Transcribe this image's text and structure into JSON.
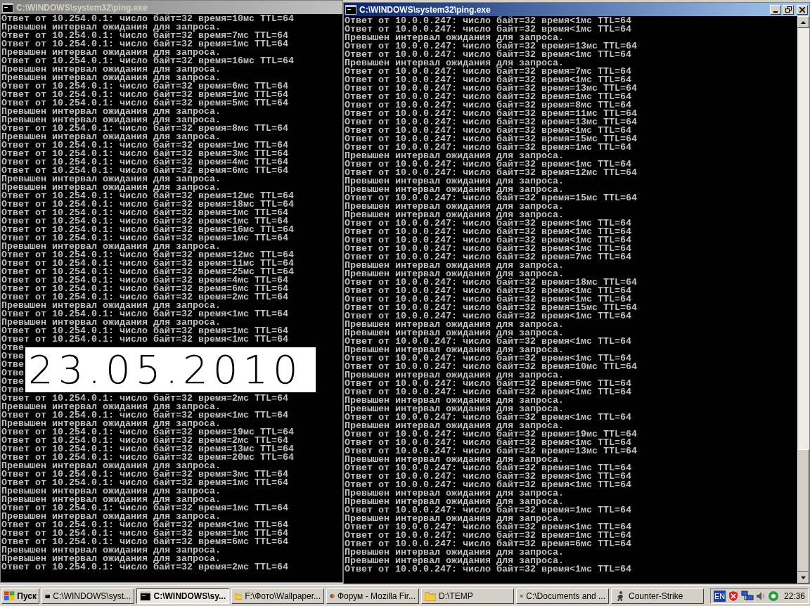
{
  "windows": [
    {
      "title": "C:\\WINDOWS\\system32\\ping.exe",
      "active": false,
      "lines": [
        "Ответ от 10.254.0.1: число байт=32 время=10мс TTL=64",
        "Превышен интервал ожидания для запроса.",
        "Ответ от 10.254.0.1: число байт=32 время=7мс TTL=64",
        "Ответ от 10.254.0.1: число байт=32 время=1мс TTL=64",
        "Превышен интервал ожидания для запроса.",
        "Ответ от 10.254.0.1: число байт=32 время=16мс TTL=64",
        "Превышен интервал ожидания для запроса.",
        "Превышен интервал ожидания для запроса.",
        "Ответ от 10.254.0.1: число байт=32 время=6мс TTL=64",
        "Ответ от 10.254.0.1: число байт=32 время=1мс TTL=64",
        "Ответ от 10.254.0.1: число байт=32 время=5мс TTL=64",
        "Превышен интервал ожидания для запроса.",
        "Превышен интервал ожидания для запроса.",
        "Ответ от 10.254.0.1: число байт=32 время=8мс TTL=64",
        "Превышен интервал ожидания для запроса.",
        "Ответ от 10.254.0.1: число байт=32 время=1мс TTL=64",
        "Ответ от 10.254.0.1: число байт=32 время=3мс TTL=64",
        "Ответ от 10.254.0.1: число байт=32 время=4мс TTL=64",
        "Ответ от 10.254.0.1: число байт=32 время=6мс TTL=64",
        "Превышен интервал ожидания для запроса.",
        "Превышен интервал ожидания для запроса.",
        "Ответ от 10.254.0.1: число байт=32 время=12мс TTL=64",
        "Ответ от 10.254.0.1: число байт=32 время=18мс TTL=64",
        "Ответ от 10.254.0.1: число байт=32 время=1мс TTL=64",
        "Ответ от 10.254.0.1: число байт=32 время<1мс TTL=64",
        "Ответ от 10.254.0.1: число байт=32 время=16мс TTL=64",
        "Ответ от 10.254.0.1: число байт=32 время=1мс TTL=64",
        "Превышен интервал ожидания для запроса.",
        "Ответ от 10.254.0.1: число байт=32 время=12мс TTL=64",
        "Ответ от 10.254.0.1: число байт=32 время=11мс TTL=64",
        "Ответ от 10.254.0.1: число байт=32 время=25мс TTL=64",
        "Ответ от 10.254.0.1: число байт=32 время=4мс TTL=64",
        "Ответ от 10.254.0.1: число байт=32 время=6мс TTL=64",
        "Ответ от 10.254.0.1: число байт=32 время=2мс TTL=64",
        "Превышен интервал ожидания для запроса.",
        "Ответ от 10.254.0.1: число байт=32 время<1мс TTL=64",
        "Превышен интервал ожидания для запроса.",
        "Ответ от 10.254.0.1: число байт=32 время=1мс TTL=64",
        "Ответ от 10.254.0.1: число байт=32 время<1мс TTL=64",
        "Отве",
        "Отве",
        "Отве",
        "Отве",
        "Отве",
        "Отве",
        "Ответ от 10.254.0.1: число байт=32 время=2мс TTL=64",
        "Превышен интервал ожидания для запроса.",
        "Ответ от 10.254.0.1: число байт=32 время<1мс TTL=64",
        "Превышен интервал ожидания для запроса.",
        "Ответ от 10.254.0.1: число байт=32 время=19мс TTL=64",
        "Ответ от 10.254.0.1: число байт=32 время=2мс TTL=64",
        "Ответ от 10.254.0.1: число байт=32 время=13мс TTL=64",
        "Ответ от 10.254.0.1: число байт=32 время=20мс TTL=64",
        "Превышен интервал ожидания для запроса.",
        "Ответ от 10.254.0.1: число байт=32 время=3мс TTL=64",
        "Ответ от 10.254.0.1: число байт=32 время=1мс TTL=64",
        "Превышен интервал ожидания для запроса.",
        "Превышен интервал ожидания для запроса.",
        "Ответ от 10.254.0.1: число байт=32 время=1мс TTL=64",
        "Превышен интервал ожидания для запроса.",
        "Ответ от 10.254.0.1: число байт=32 время<1мс TTL=64",
        "Ответ от 10.254.0.1: число байт=32 время=1мс TTL=64",
        "Ответ от 10.254.0.1: число байт=32 время=6мс TTL=64",
        "Превышен интервал ожидания для запроса.",
        "Превышен интервал ожидания для запроса.",
        "Ответ от 10.254.0.1: число байт=32 время=2мс TTL=64"
      ]
    },
    {
      "title": "C:\\WINDOWS\\system32\\ping.exe",
      "active": true,
      "lines": [
        "Ответ от 10.0.0.247: число байт=32 время<1мс TTL=64",
        "Ответ от 10.0.0.247: число байт=32 время<1мс TTL=64",
        "Превышен интервал ожидания для запроса.",
        "Ответ от 10.0.0.247: число байт=32 время=13мс TTL=64",
        "Ответ от 10.0.0.247: число байт=32 время<1мс TTL=64",
        "Превышен интервал ожидания для запроса.",
        "Ответ от 10.0.0.247: число байт=32 время=7мс TTL=64",
        "Ответ от 10.0.0.247: число байт=32 время<1мс TTL=64",
        "Ответ от 10.0.0.247: число байт=32 время=13мс TTL=64",
        "Ответ от 10.0.0.247: число байт=32 время=1мс TTL=64",
        "Ответ от 10.0.0.247: число байт=32 время=8мс TTL=64",
        "Ответ от 10.0.0.247: число байт=32 время=11мс TTL=64",
        "Ответ от 10.0.0.247: число байт=32 время=13мс TTL=64",
        "Ответ от 10.0.0.247: число байт=32 время<1мс TTL=64",
        "Ответ от 10.0.0.247: число байт=32 время=15мс TTL=64",
        "Ответ от 10.0.0.247: число байт=32 время=1мс TTL=64",
        "Превышен интервал ожидания для запроса.",
        "Ответ от 10.0.0.247: число байт=32 время<1мс TTL=64",
        "Ответ от 10.0.0.247: число байт=32 время=12мс TTL=64",
        "Превышен интервал ожидания для запроса.",
        "Превышен интервал ожидания для запроса.",
        "Ответ от 10.0.0.247: число байт=32 время=15мс TTL=64",
        "Превышен интервал ожидания для запроса.",
        "Превышен интервал ожидания для запроса.",
        "Ответ от 10.0.0.247: число байт=32 время<1мс TTL=64",
        "Ответ от 10.0.0.247: число байт=32 время<1мс TTL=64",
        "Ответ от 10.0.0.247: число байт=32 время<1мс TTL=64",
        "Ответ от 10.0.0.247: число байт=32 время<1мс TTL=64",
        "Ответ от 10.0.0.247: число байт=32 время=7мс TTL=64",
        "Превышен интервал ожидания для запроса.",
        "Превышен интервал ожидания для запроса.",
        "Ответ от 10.0.0.247: число байт=32 время=18мс TTL=64",
        "Ответ от 10.0.0.247: число байт=32 время<1мс TTL=64",
        "Ответ от 10.0.0.247: число байт=32 время<1мс TTL=64",
        "Ответ от 10.0.0.247: число байт=32 время=15мс TTL=64",
        "Ответ от 10.0.0.247: число байт=32 время<1мс TTL=64",
        "Превышен интервал ожидания для запроса.",
        "Превышен интервал ожидания для запроса.",
        "Ответ от 10.0.0.247: число байт=32 время<1мс TTL=64",
        "Превышен интервал ожидания для запроса.",
        "Ответ от 10.0.0.247: число байт=32 время<1мс TTL=64",
        "Ответ от 10.0.0.247: число байт=32 время=10мс TTL=64",
        "Превышен интервал ожидания для запроса.",
        "Ответ от 10.0.0.247: число байт=32 время=6мс TTL=64",
        "Ответ от 10.0.0.247: число байт=32 время<1мс TTL=64",
        "Превышен интервал ожидания для запроса.",
        "Превышен интервал ожидания для запроса.",
        "Ответ от 10.0.0.247: число байт=32 время<1мс TTL=64",
        "Превышен интервал ожидания для запроса.",
        "Ответ от 10.0.0.247: число байт=32 время=19мс TTL=64",
        "Ответ от 10.0.0.247: число байт=32 время<1мс TTL=64",
        "Ответ от 10.0.0.247: число байт=32 время=13мс TTL=64",
        "Превышен интервал ожидания для запроса.",
        "Ответ от 10.0.0.247: число байт=32 время=1мс TTL=64",
        "Ответ от 10.0.0.247: число байт=32 время<1мс TTL=64",
        "Ответ от 10.0.0.247: число байт=32 время<1мс TTL=64",
        "Превышен интервал ожидания для запроса.",
        "Превышен интервал ожидания для запроса.",
        "Ответ от 10.0.0.247: число байт=32 время=1мс TTL=64",
        "Превышен интервал ожидания для запроса.",
        "Ответ от 10.0.0.247: число байт=32 время<1мс TTL=64",
        "Ответ от 10.0.0.247: число байт=32 время=1мс TTL=64",
        "Ответ от 10.0.0.247: число байт=32 время=6мс TTL=64",
        "Превышен интервал ожидания для запроса.",
        "Превышен интервал ожидания для запроса.",
        "Ответ от 10.0.0.247: число байт=32 время<1мс TTL=64"
      ]
    }
  ],
  "date_stamp": "23.05.2010",
  "taskbar": {
    "start": "Пуск",
    "tasks": [
      {
        "label": "C:\\WINDOWS\\syst...",
        "kind": "console",
        "selected": false
      },
      {
        "label": "C:\\WINDOWS\\sy...",
        "kind": "console",
        "selected": true
      },
      {
        "label": "F:\\Фото\\Wallpaper...",
        "kind": "folder",
        "selected": false
      },
      {
        "label": "Форум - Mozilla Fir...",
        "kind": "browser",
        "selected": false
      },
      {
        "label": "D:\\TEMP",
        "kind": "folder",
        "selected": false
      },
      {
        "label": "C:\\Documents and ...",
        "kind": "script",
        "selected": false
      },
      {
        "label": "Counter-Strike",
        "kind": "game",
        "selected": false
      }
    ],
    "language": "EN",
    "clock": "22:36"
  }
}
